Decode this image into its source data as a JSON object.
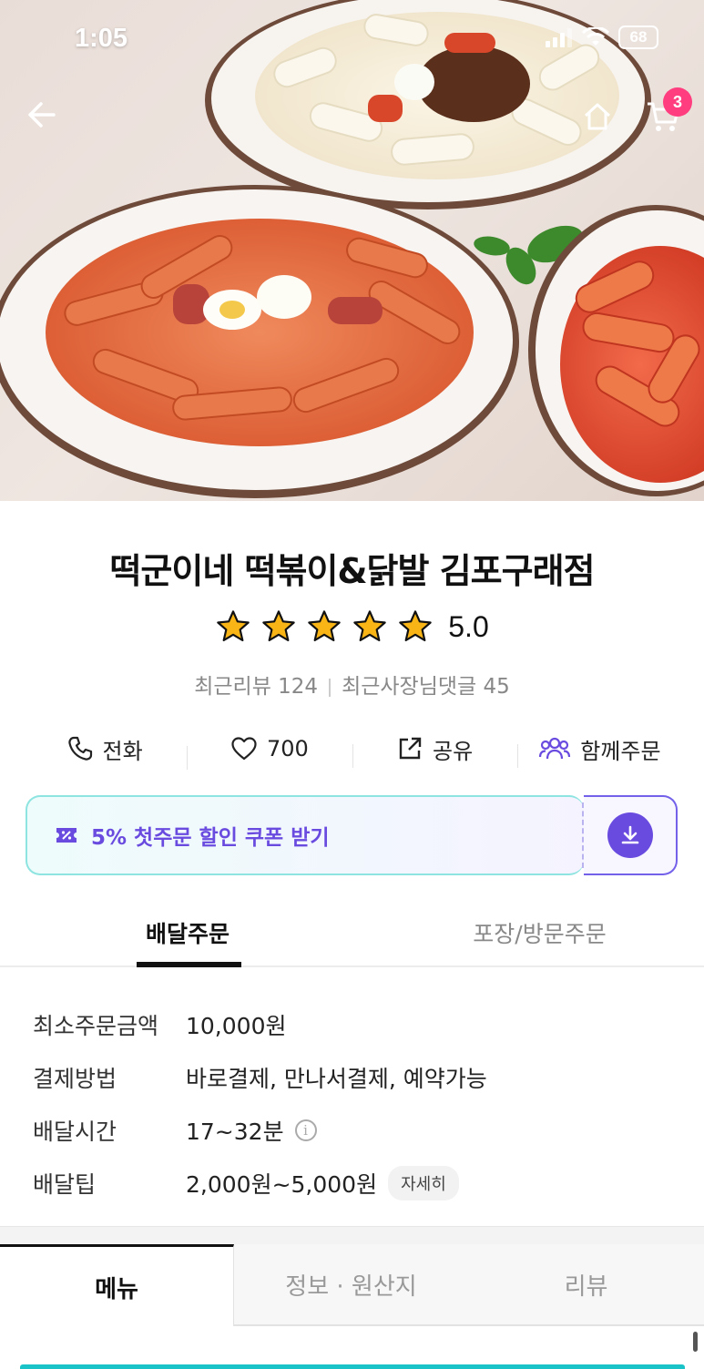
{
  "status_bar": {
    "time": "1:05",
    "battery": "68"
  },
  "header": {
    "cart_count": "3"
  },
  "store": {
    "name": "떡군이네 떡볶이&닭발 김포구래점",
    "rating": "5.0",
    "rating_stars": 5,
    "recent_reviews": "최근리뷰 124",
    "owner_replies": "최근사장님댓글 45"
  },
  "actions": {
    "call": "전화",
    "likes": "700",
    "share": "공유",
    "group_order": "함께주문"
  },
  "coupon": {
    "label": "5% 첫주문 할인 쿠폰 받기"
  },
  "order_tabs": {
    "delivery": "배달주문",
    "pickup": "포장/방문주문"
  },
  "info": {
    "min_order_key": "최소주문금액",
    "min_order_val": "10,000원",
    "payment_key": "결제방법",
    "payment_val": "바로결제, 만나서결제, 예약가능",
    "time_key": "배달시간",
    "time_val": "17~32분",
    "tip_key": "배달팁",
    "tip_val": "2,000원~5,000원",
    "tip_detail": "자세히"
  },
  "menu_tabs": {
    "menu": "메뉴",
    "info": "정보 · 원산지",
    "review": "리뷰"
  },
  "colors": {
    "accent_purple": "#6a4be0",
    "badge_pink": "#ff3d7f",
    "star": "#f9b515"
  }
}
